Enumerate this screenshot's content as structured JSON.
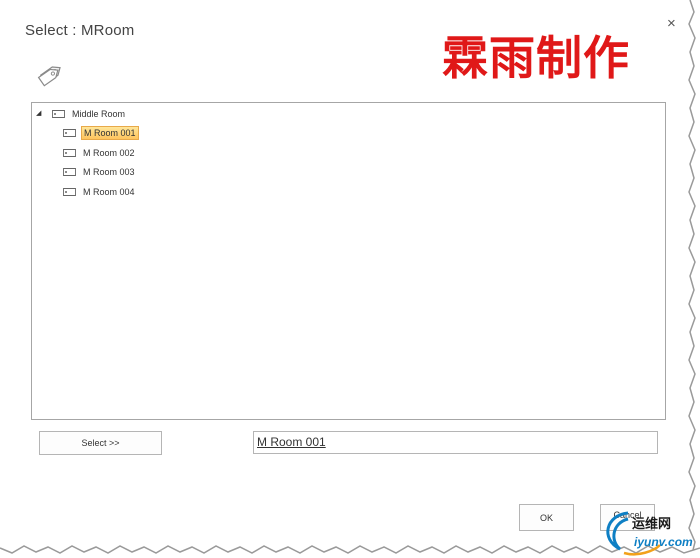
{
  "dialog": {
    "title": "Select : MRoom",
    "close_label": "×",
    "header_icon": "tag-icon"
  },
  "watermark": {
    "text": "霖雨制作",
    "color": "#e01818"
  },
  "tree": {
    "root": {
      "label": "Middle Room",
      "expanded": true,
      "icon": "tag-icon"
    },
    "children": [
      {
        "label": "M Room 001",
        "selected": true,
        "icon": "tag-icon"
      },
      {
        "label": "M Room 002",
        "selected": false,
        "icon": "tag-icon"
      },
      {
        "label": "M Room 003",
        "selected": false,
        "icon": "tag-icon"
      },
      {
        "label": "M Room 004",
        "selected": false,
        "icon": "tag-icon"
      }
    ]
  },
  "actions": {
    "select_label": "Select >>",
    "result_value": "M Room 001",
    "ok_label": "OK",
    "cancel_label": "Cancel"
  },
  "site_logo": {
    "cn": "运维网",
    "en": "iyunv.com",
    "accent": "#0e7fc4"
  }
}
